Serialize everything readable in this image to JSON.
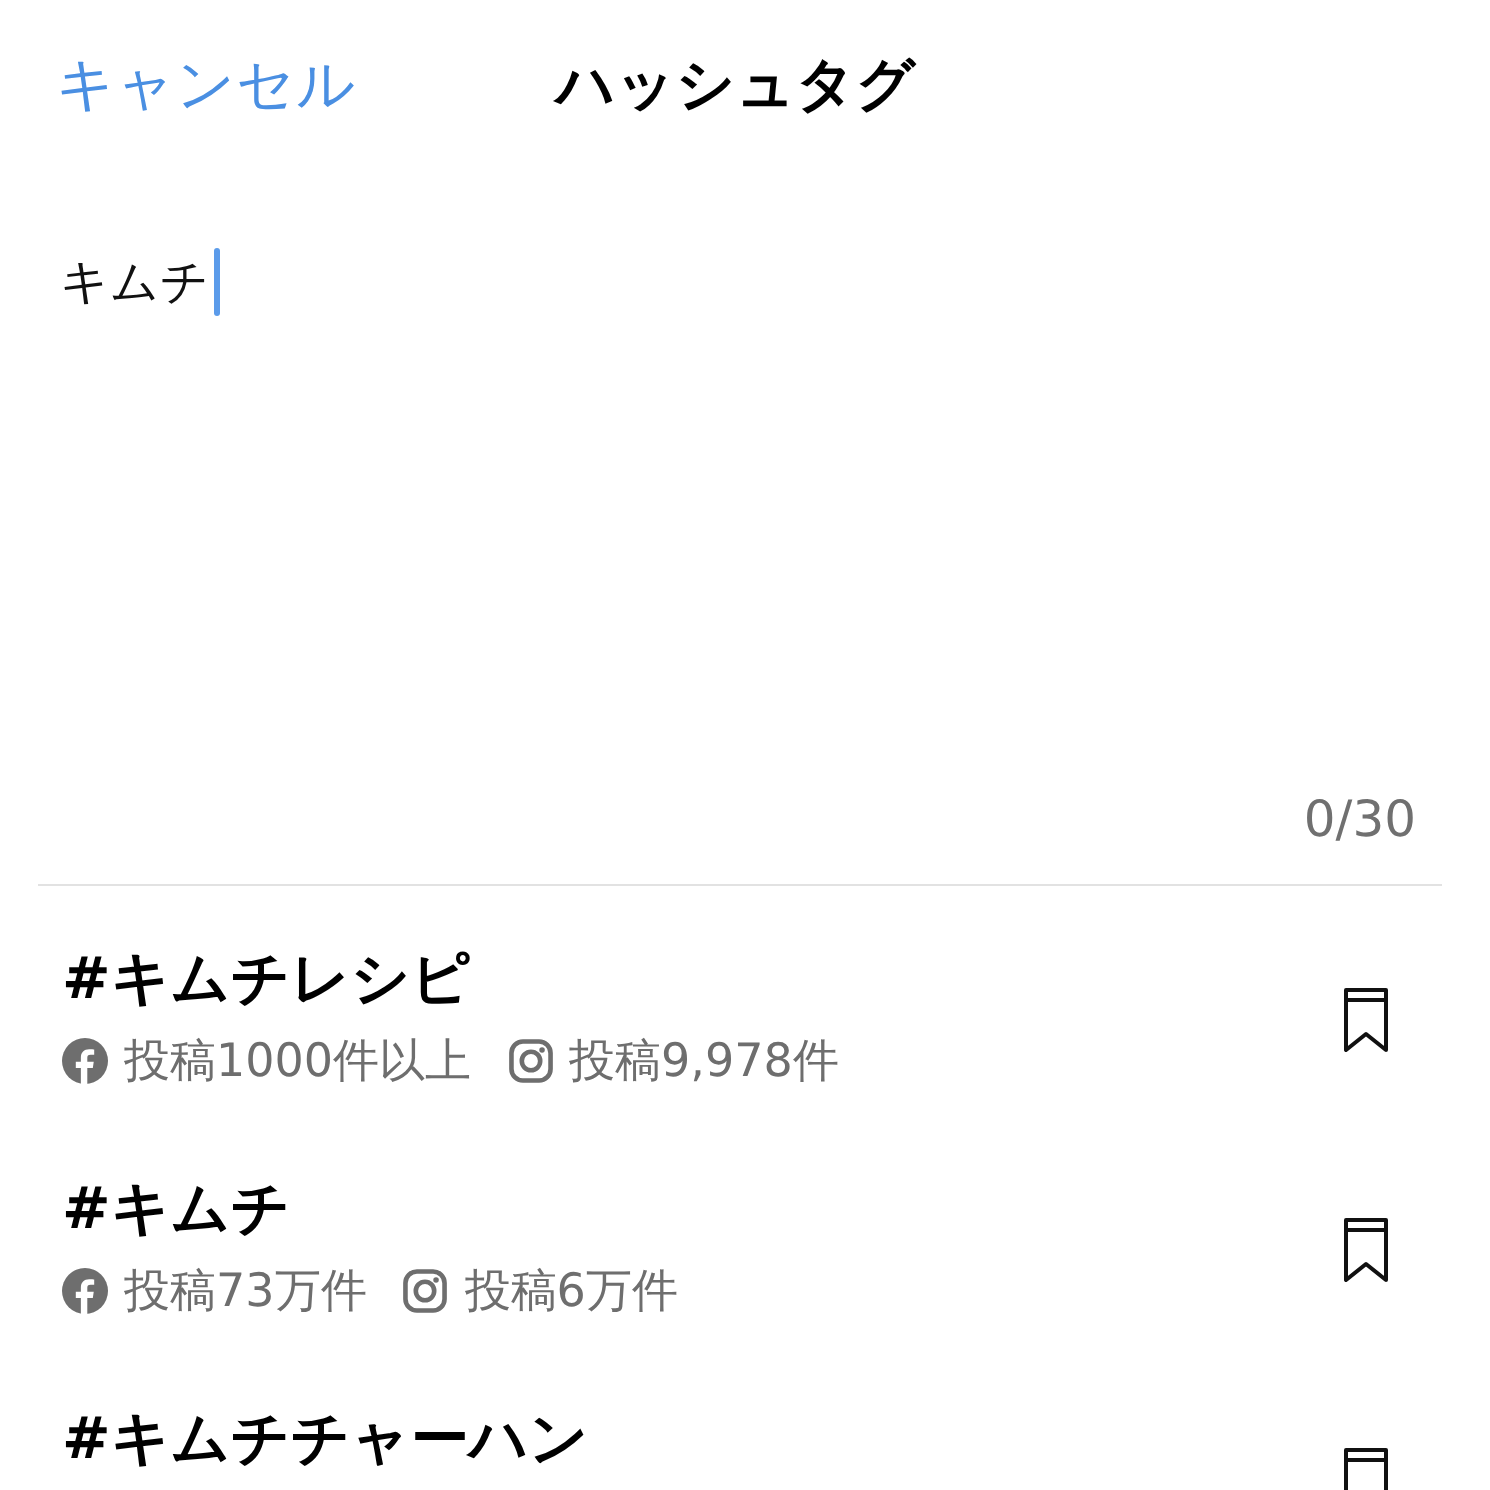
{
  "header": {
    "cancel": "キャンセル",
    "title": "ハッシュタグ"
  },
  "input": {
    "value": "キムチ",
    "counter": "0/30"
  },
  "results": [
    {
      "tag": "#キムチレシピ",
      "stats": [
        {
          "kind": "facebook",
          "text": "投稿1000件以上"
        },
        {
          "kind": "instagram",
          "text": "投稿9,978件"
        }
      ],
      "bookmarked": false
    },
    {
      "tag": "#キムチ",
      "stats": [
        {
          "kind": "facebook",
          "text": "投稿73万件"
        },
        {
          "kind": "instagram",
          "text": "投稿6万件"
        }
      ],
      "bookmarked": false
    },
    {
      "tag": "#キムチチャーハン",
      "bookmarked": false
    }
  ]
}
